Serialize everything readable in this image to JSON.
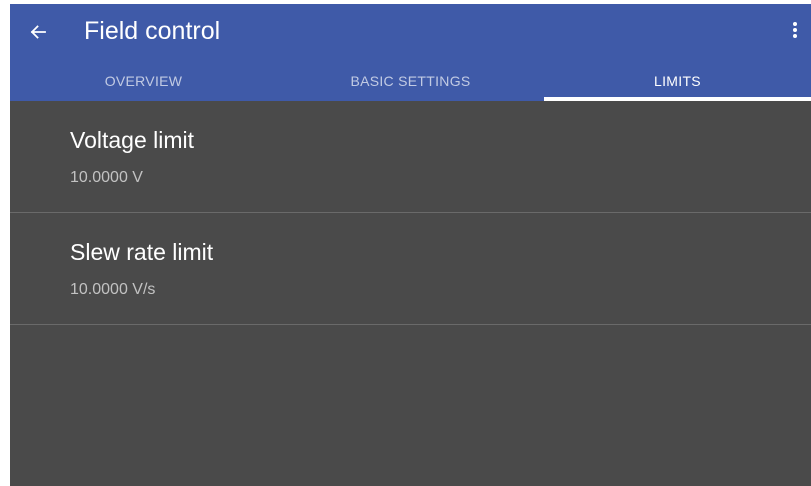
{
  "appbar": {
    "title": "Field control",
    "back_icon": "arrow-left-icon",
    "overflow_icon": "more-vertical-icon",
    "color": "#3f5aa8"
  },
  "tabs": [
    {
      "label": "OVERVIEW",
      "active": false
    },
    {
      "label": "BASIC SETTINGS",
      "active": false
    },
    {
      "label": "LIMITS",
      "active": true
    }
  ],
  "limits": [
    {
      "title": "Voltage limit",
      "value": "10.0000 V"
    },
    {
      "title": "Slew rate limit",
      "value": "10.0000 V/s"
    }
  ],
  "theme": {
    "background": "#4a4a4a",
    "divider": "#6a6a6a",
    "secondary_text": "#c2c2c2"
  }
}
